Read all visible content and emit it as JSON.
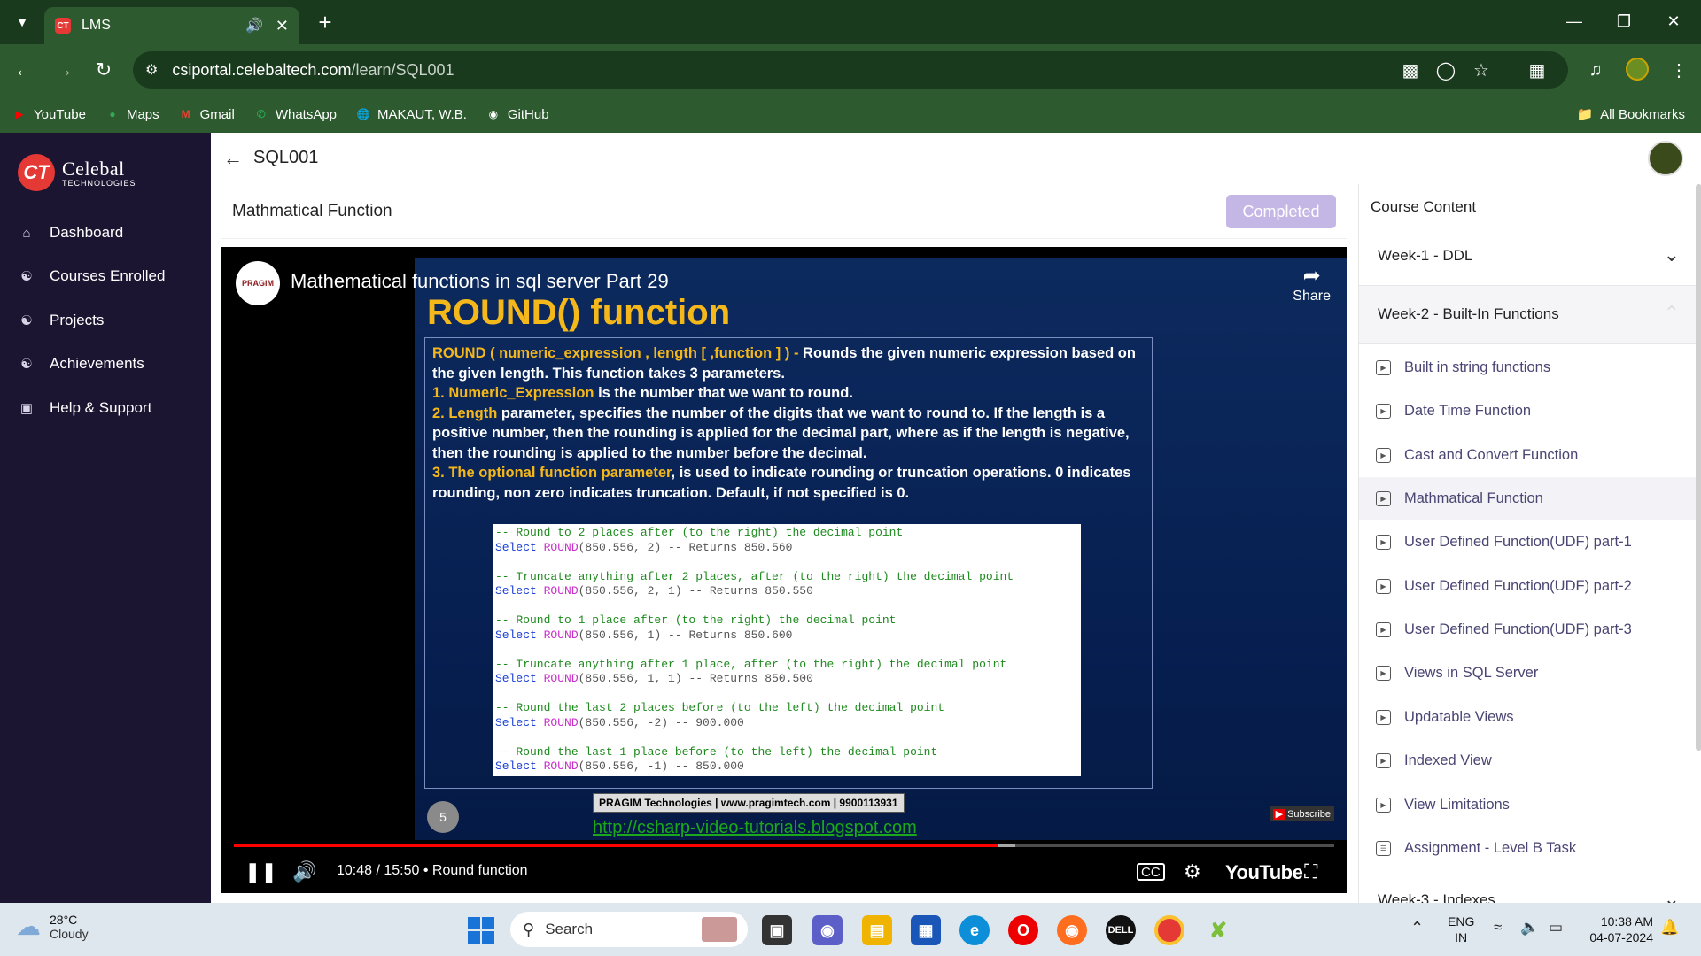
{
  "browser": {
    "tab_title": "LMS",
    "tab_favicon": "CT",
    "url_host": "csiportal.celebaltech.com",
    "url_path": "/learn/SQL001",
    "bookmarks": [
      {
        "label": "YouTube",
        "icon": "youtube-icon",
        "color": "#ff0000"
      },
      {
        "label": "Maps",
        "icon": "maps-icon",
        "color": "#34a853"
      },
      {
        "label": "Gmail",
        "icon": "gmail-icon",
        "color": "#ea4335"
      },
      {
        "label": "WhatsApp",
        "icon": "whatsapp-icon",
        "color": "#25d366"
      },
      {
        "label": "MAKAUT, W.B.",
        "icon": "globe-icon",
        "color": "#ffffff"
      },
      {
        "label": "GitHub",
        "icon": "github-icon",
        "color": "#ffffff"
      }
    ],
    "all_bookmarks": "All Bookmarks"
  },
  "sidebar": {
    "logo_mark": "CT",
    "logo_big": "Celebal",
    "logo_small": "TECHNOLOGIES",
    "items": [
      {
        "label": "Dashboard",
        "icon": "home-icon"
      },
      {
        "label": "Courses Enrolled",
        "icon": "users-icon"
      },
      {
        "label": "Projects",
        "icon": "users-icon"
      },
      {
        "label": "Achievements",
        "icon": "users-icon"
      },
      {
        "label": "Help & Support",
        "icon": "calendar-icon"
      }
    ]
  },
  "header": {
    "course_code": "SQL001"
  },
  "lesson": {
    "title": "Mathmatical Function",
    "completed_label": "Completed"
  },
  "video": {
    "channel_logo_text": "PRAGIM",
    "title": "Mathematical functions in sql server Part 29",
    "share_label": "Share",
    "slide_heading": "ROUND() function",
    "slide_p1_hl": "ROUND ( numeric_expression , length [ ,function ] ) -",
    "slide_p1": " Rounds the given numeric expression based on the given length. This function takes 3 parameters.",
    "slide_p2_hl": "1. Numeric_Expression",
    "slide_p2": " is the number that we want to round.",
    "slide_p3_hl": "2. Length",
    "slide_p3": " parameter, specifies the number of the digits that we want to round to. If the length is a positive number, then the rounding is applied for the decimal part, where as if the length is negative, then the rounding is applied to the number before the decimal.",
    "slide_p4_hl": "3. The optional function parameter",
    "slide_p4": ", is used to indicate rounding or truncation operations. 0 indicates rounding, non zero indicates truncation. Default, if not specified is 0.",
    "code": [
      {
        "comment": "-- Round to 2 places after (to the right) the decimal point",
        "args": "(850.556, 2)",
        "ret": " -- Returns 850.560"
      },
      {
        "comment": "-- Truncate anything after 2 places, after (to the right) the decimal point",
        "args": "(850.556, 2, 1)",
        "ret": " -- Returns 850.550"
      },
      {
        "comment": "-- Round to 1 place after (to the right) the decimal point",
        "args": "(850.556, 1)",
        "ret": " -- Returns 850.600"
      },
      {
        "comment": "-- Truncate anything after 1 place, after (to the right) the decimal point",
        "args": "(850.556, 1, 1)",
        "ret": " -- Returns 850.500"
      },
      {
        "comment": "-- Round the last 2 places before (to the left) the decimal point",
        "args": "(850.556, -2)",
        "ret": " -- 900.000"
      },
      {
        "comment": "-- Round the last 1 place before (to the left) the decimal point",
        "args": "(850.556, -1)",
        "ret": " -- 850.000"
      }
    ],
    "code_select": "Select ",
    "code_round": "ROUND",
    "slide_number": "5",
    "footer_tag": "PRAGIM Technologies | www.pragimtech.com | 9900113931",
    "footer_link": "http://csharp-video-tutorials.blogspot.com",
    "subscribe": "Subscribe",
    "time": "10:48 / 15:50",
    "chapter": "Round function",
    "progress_fraction": 0.695,
    "buffered_fraction": 0.71,
    "youtube_brand": "YouTube"
  },
  "course_content": {
    "title": "Course Content",
    "weeks": [
      {
        "title": "Week-1 - DDL"
      },
      {
        "title": "Week-2 - Built-In Functions"
      },
      {
        "title": "Week-3 - Indexes"
      }
    ],
    "lessons": [
      {
        "label": "Built in string functions",
        "icon": "video-icon"
      },
      {
        "label": "Date Time Function",
        "icon": "video-icon"
      },
      {
        "label": "Cast and Convert Function",
        "icon": "video-icon"
      },
      {
        "label": "Mathmatical Function",
        "icon": "video-icon"
      },
      {
        "label": "User Defined Function(UDF) part-1",
        "icon": "video-icon"
      },
      {
        "label": "User Defined Function(UDF) part-2",
        "icon": "video-icon"
      },
      {
        "label": "User Defined Function(UDF) part-3",
        "icon": "video-icon"
      },
      {
        "label": "Views in SQL Server",
        "icon": "video-icon"
      },
      {
        "label": "Updatable Views",
        "icon": "video-icon"
      },
      {
        "label": "Indexed View",
        "icon": "video-icon"
      },
      {
        "label": "View Limitations",
        "icon": "video-icon"
      },
      {
        "label": "Assignment - Level B Task",
        "icon": "document-icon"
      }
    ]
  },
  "taskbar": {
    "temperature": "28°C",
    "weather": "Cloudy",
    "search_placeholder": "Search",
    "lang_1": "ENG",
    "lang_2": "IN",
    "time": "10:38 AM",
    "date": "04-07-2024"
  }
}
